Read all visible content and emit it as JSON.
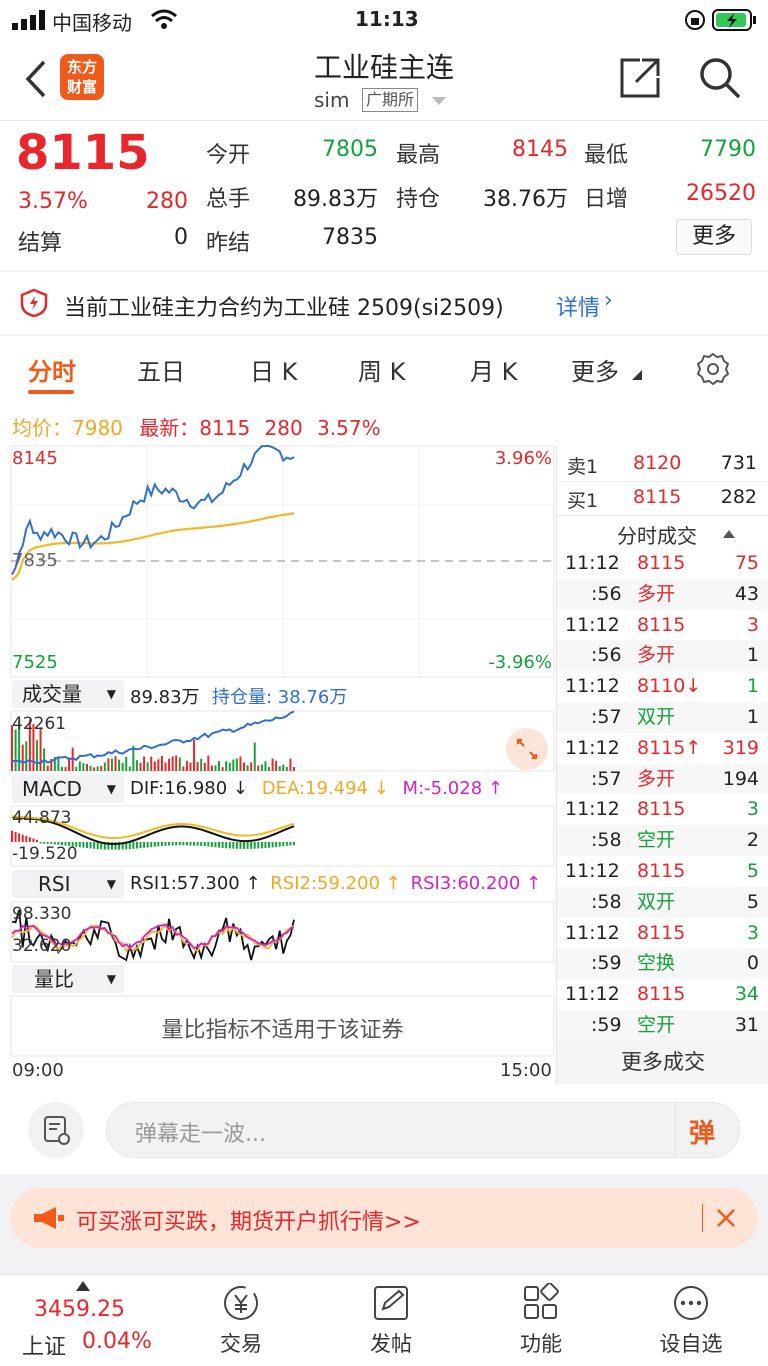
{
  "status_bar": {
    "carrier": "中国移动",
    "time": "11:13"
  },
  "nav": {
    "title": "工业硅主连",
    "subtitle": "sim",
    "exchange": "广期所",
    "logo_line1": "东方",
    "logo_line2": "财富"
  },
  "quote": {
    "price": "8115",
    "change_pct": "3.57%",
    "change": "280",
    "settle_label": "结算",
    "settle": "0",
    "open_label": "今开",
    "open": "7805",
    "volume_label": "总手",
    "volume": "89.83万",
    "prev_settle_label": "昨结",
    "prev_settle": "7835",
    "high_label": "最高",
    "high": "8145",
    "oi_label": "持仓",
    "oi": "38.76万",
    "low_label": "最低",
    "low": "7790",
    "daily_inc_label": "日增",
    "daily_inc": "26520",
    "more_label": "更多"
  },
  "notice": {
    "text": "当前工业硅主力合约为工业硅 2509(si2509)",
    "link": "详情"
  },
  "tabs": [
    {
      "label": "分时"
    },
    {
      "label": "五日"
    },
    {
      "label": "日 K"
    },
    {
      "label": "周 K"
    },
    {
      "label": "月 K"
    },
    {
      "label": "更多"
    }
  ],
  "legend": {
    "avg_label": "均价：",
    "avg": "7980",
    "latest_label": "最新：",
    "latest": "8115",
    "chg": "280",
    "pct": "3.57%"
  },
  "price_axis": {
    "top": "8145",
    "mid": "7835",
    "bottom": "7525",
    "top_pct": "3.96%",
    "bottom_pct": "-3.96%"
  },
  "volume_panel": {
    "btn": "成交量",
    "vol": "89.83万",
    "oi_label": "持仓量: 38.76万",
    "max": "42261"
  },
  "macd_panel": {
    "btn": "MACD",
    "dif": "DIF:16.980 ↓",
    "dea": "DEA:19.494 ↓",
    "m": "M:-5.028 ↑",
    "max": "44.873",
    "min": "-19.520"
  },
  "rsi_panel": {
    "btn": "RSI",
    "rsi1": "RSI1:57.300 ↑",
    "rsi2": "RSI2:59.200 ↑",
    "rsi3": "RSI3:60.200 ↑",
    "max": "98.330",
    "min": "32.620"
  },
  "ratio_panel": {
    "btn": "量比",
    "msg": "量比指标不适用于该证券"
  },
  "time_axis": {
    "start": "09:00",
    "end": "15:00"
  },
  "order_book": {
    "ask_label": "卖1",
    "ask_price": "8120",
    "ask_vol": "731",
    "bid_label": "买1",
    "bid_price": "8115",
    "bid_vol": "282"
  },
  "trades_header": "分时成交",
  "trades": [
    {
      "t": "11:12",
      "p": "8115",
      "v": "75",
      "pc": "red",
      "vc": "red"
    },
    {
      "t": ":56",
      "p": "多开",
      "v": "43",
      "pc": "red",
      "vc": "dark"
    },
    {
      "t": "11:12",
      "p": "8115",
      "v": "3",
      "pc": "red",
      "vc": "red"
    },
    {
      "t": ":56",
      "p": "多开",
      "v": "1",
      "pc": "red",
      "vc": "dark"
    },
    {
      "t": "11:12",
      "p": "8110↓",
      "v": "1",
      "pc": "red",
      "vc": "green"
    },
    {
      "t": ":57",
      "p": "双开",
      "v": "1",
      "pc": "green",
      "vc": "dark"
    },
    {
      "t": "11:12",
      "p": "8115↑",
      "v": "319",
      "pc": "red",
      "vc": "red"
    },
    {
      "t": ":57",
      "p": "多开",
      "v": "194",
      "pc": "red",
      "vc": "dark"
    },
    {
      "t": "11:12",
      "p": "8115",
      "v": "3",
      "pc": "red",
      "vc": "green"
    },
    {
      "t": ":58",
      "p": "空开",
      "v": "2",
      "pc": "green",
      "vc": "dark"
    },
    {
      "t": "11:12",
      "p": "8115",
      "v": "5",
      "pc": "red",
      "vc": "green"
    },
    {
      "t": ":58",
      "p": "双开",
      "v": "5",
      "pc": "green",
      "vc": "dark"
    },
    {
      "t": "11:12",
      "p": "8115",
      "v": "3",
      "pc": "red",
      "vc": "green"
    },
    {
      "t": ":59",
      "p": "空换",
      "v": "0",
      "pc": "green",
      "vc": "dark"
    },
    {
      "t": "11:12",
      "p": "8115",
      "v": "34",
      "pc": "red",
      "vc": "green"
    },
    {
      "t": ":59",
      "p": "空开",
      "v": "31",
      "pc": "green",
      "vc": "dark"
    }
  ],
  "more_trades": "更多成交",
  "input": {
    "placeholder": "弹幕走一波...",
    "send": "弹"
  },
  "promo": {
    "text": "可买涨可买跌，期货开户抓行情>>"
  },
  "bottom_nav": {
    "index_value": "3459.25",
    "index_name": "上证",
    "index_pct": "0.04%",
    "trade": "交易",
    "post": "发帖",
    "func": "功能",
    "watch": "设自选"
  },
  "colors": {
    "up": "#e8262b",
    "down": "#14a33a",
    "avg": "#f5a623",
    "price_line": "#2f6fd0",
    "accent": "#f05a1a"
  }
}
